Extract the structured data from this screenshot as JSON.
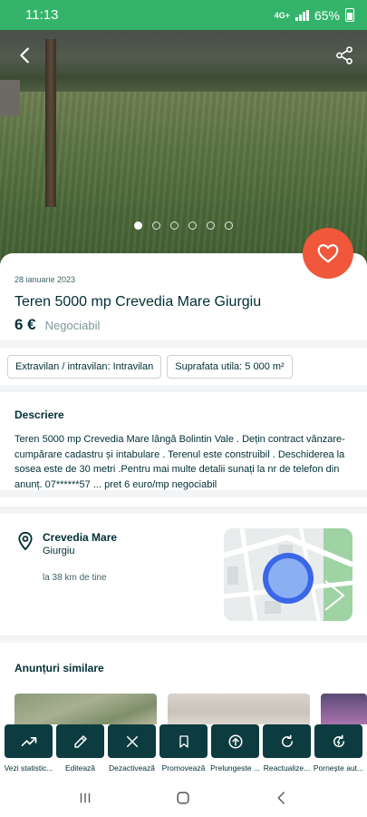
{
  "status_bar": {
    "time": "11:13",
    "network": "4G+",
    "battery": "65%"
  },
  "gallery": {
    "image_count": 6,
    "active_index": 0
  },
  "listing": {
    "date": "28 ianuarie 2023",
    "title": "Teren 5000 mp Crevedia Mare Giurgiu",
    "price": "6 €",
    "negotiable": "Negociabil"
  },
  "tags": [
    {
      "text": "Extravilan / intravilan: Intravilan"
    },
    {
      "text": "Suprafata utila: 5 000 m²"
    }
  ],
  "description": {
    "heading": "Descriere",
    "text": "Teren 5000 mp Crevedia Mare lângă Bolintin Vale . Dețin contract vânzare-cumpărare cadastru și intabulare . Terenul este construibil . Deschiderea la sosea este de 30 metri .Pentru mai multe detalii sunați la nr de telefon din anunț. 07******57 ... pret 6 euro/mp negociabil"
  },
  "location": {
    "city": "Crevedia Mare",
    "region": "Giurgiu",
    "distance": "la 38 km de tine"
  },
  "similar": {
    "heading": "Anunțuri similare"
  },
  "actions": [
    {
      "label": "Vezi statistic...",
      "icon": "trending-up-icon"
    },
    {
      "label": "Editează",
      "icon": "pencil-icon"
    },
    {
      "label": "Dezactivează",
      "icon": "close-icon"
    },
    {
      "label": "Promovează",
      "icon": "bookmark-icon"
    },
    {
      "label": "Prelungeste ...",
      "icon": "arrow-up-circle-icon"
    },
    {
      "label": "Reactualize...",
      "icon": "refresh-icon"
    },
    {
      "label": "Pornește aut...",
      "icon": "auto-renew-icon"
    }
  ],
  "colors": {
    "status_bar": "#33b46a",
    "favorite": "#f0573b",
    "primary_dark": "#0d3c40",
    "text": "#002f34"
  }
}
